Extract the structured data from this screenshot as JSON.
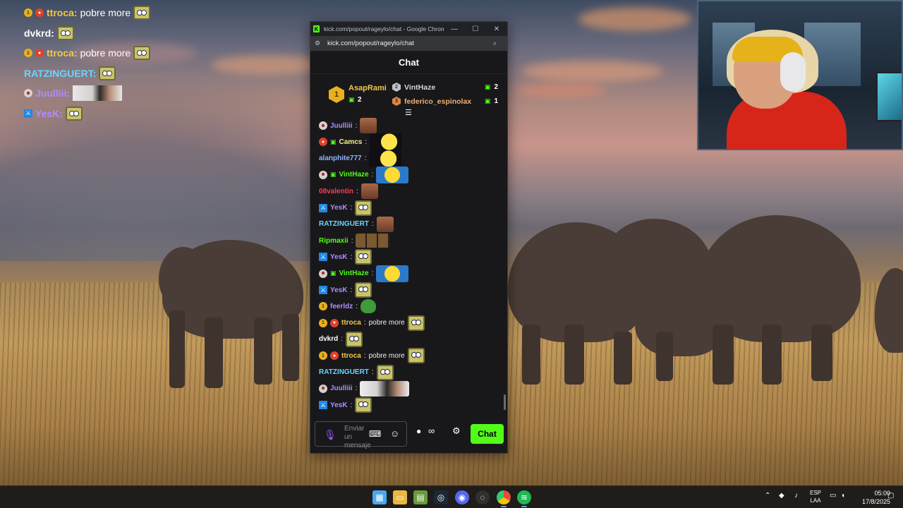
{
  "overlay_chat": [
    {
      "badges": [
        "gold-1",
        "red"
      ],
      "user": "ttroca",
      "user_color": "#f2c84b",
      "message": "pobre more",
      "emote": "sponge"
    },
    {
      "badges": [],
      "user": "dvkrd",
      "user_color": "#ffffff",
      "message": "",
      "emote": "sponge"
    },
    {
      "badges": [
        "gold-1",
        "red"
      ],
      "user": "ttroca",
      "user_color": "#f2c84b",
      "message": "pobre more",
      "emote": "sponge"
    },
    {
      "badges": [],
      "user": "RATZINGUERT",
      "user_color": "#6ad5ff",
      "message": "",
      "emote": "sponge"
    },
    {
      "badges": [
        "skull"
      ],
      "user": "Juulliii",
      "user_color": "#b08cff",
      "message": "",
      "emote": "wide-face"
    },
    {
      "badges": [
        "mod"
      ],
      "user": "YesK",
      "user_color": "#b08cff",
      "message": "",
      "emote": "sponge"
    }
  ],
  "window": {
    "title": "kick.com/popout/rageylo/chat - Google Chrome",
    "url": "kick.com/popout/rageylo/chat",
    "minimize": "—",
    "maximize": "☐",
    "close": "✕"
  },
  "chat": {
    "header": "Chat",
    "leaderboard": {
      "first": {
        "rank": "1",
        "name": "AsapRami",
        "gifts": "2"
      },
      "second": {
        "rank": "2",
        "name": "VintHaze",
        "gifts": "2"
      },
      "third": {
        "rank": "3",
        "name": "federico_espinolax",
        "gifts": "1"
      }
    },
    "messages": [
      {
        "badges": [
          "skull"
        ],
        "user": "Juulliii",
        "user_color": "#b08cff",
        "text": "",
        "emote": "face"
      },
      {
        "badges": [
          "red",
          "gift"
        ],
        "user": "Camcs",
        "user_color": "#f5f08a",
        "text": "",
        "emote": "chick"
      },
      {
        "badges": [],
        "user": "alanphite777",
        "user_color": "#8fb4ff",
        "text": "",
        "emote": "chick"
      },
      {
        "badges": [
          "skull",
          "gift"
        ],
        "user": "VintHaze",
        "user_color": "#53fc18",
        "text": "",
        "emote": "minion"
      },
      {
        "badges": [],
        "user": "08valentin",
        "user_color": "#ff3a5a",
        "text": "",
        "emote": "face"
      },
      {
        "badges": [
          "mod"
        ],
        "user": "YesK",
        "user_color": "#b08cff",
        "text": "",
        "emote": "sponge"
      },
      {
        "badges": [],
        "user": "RATZINGUERT",
        "user_color": "#6ad5ff",
        "text": "",
        "emote": "face"
      },
      {
        "badges": [],
        "user": "Ripmaxii",
        "user_color": "#53fc18",
        "text": "",
        "emote": "cats"
      },
      {
        "badges": [
          "mod"
        ],
        "user": "YesK",
        "user_color": "#b08cff",
        "text": "",
        "emote": "sponge"
      },
      {
        "badges": [
          "skull",
          "gift"
        ],
        "user": "VintHaze",
        "user_color": "#53fc18",
        "text": "",
        "emote": "minion"
      },
      {
        "badges": [
          "mod"
        ],
        "user": "YesK",
        "user_color": "#b08cff",
        "text": "",
        "emote": "sponge"
      },
      {
        "badges": [
          "gold-1"
        ],
        "user": "feerldz",
        "user_color": "#b08cff",
        "text": "",
        "emote": "pepe"
      },
      {
        "badges": [
          "gold-1",
          "red"
        ],
        "user": "ttroca",
        "user_color": "#f2c84b",
        "text": "pobre more",
        "emote": "sponge"
      },
      {
        "badges": [],
        "user": "dvkrd",
        "user_color": "#ffffff",
        "text": "",
        "emote": "sponge"
      },
      {
        "badges": [
          "gold-1",
          "red"
        ],
        "user": "ttroca",
        "user_color": "#f2c84b",
        "text": "pobre more",
        "emote": "sponge"
      },
      {
        "badges": [],
        "user": "RATZINGUERT",
        "user_color": "#6ad5ff",
        "text": "",
        "emote": "sponge"
      },
      {
        "badges": [
          "skull"
        ],
        "user": "Juulliii",
        "user_color": "#b08cff",
        "text": "",
        "emote": "wide-face"
      },
      {
        "badges": [
          "mod"
        ],
        "user": "YesK",
        "user_color": "#b08cff",
        "text": "",
        "emote": "sponge"
      }
    ],
    "input_placeholder": "Enviar un mensaje",
    "send_label": "Chat"
  },
  "taskbar": {
    "icons": [
      "windows-start-icon",
      "file-explorer-icon",
      "app-icon",
      "steam-icon",
      "discord-icon",
      "obs-icon",
      "chrome-icon",
      "spotify-icon"
    ],
    "language": "ESP",
    "language_sub": "LAA",
    "time": "05:00",
    "date": "17/8/2025"
  },
  "colors": {
    "kick_green": "#53fc18",
    "chat_bg": "#18181b"
  }
}
